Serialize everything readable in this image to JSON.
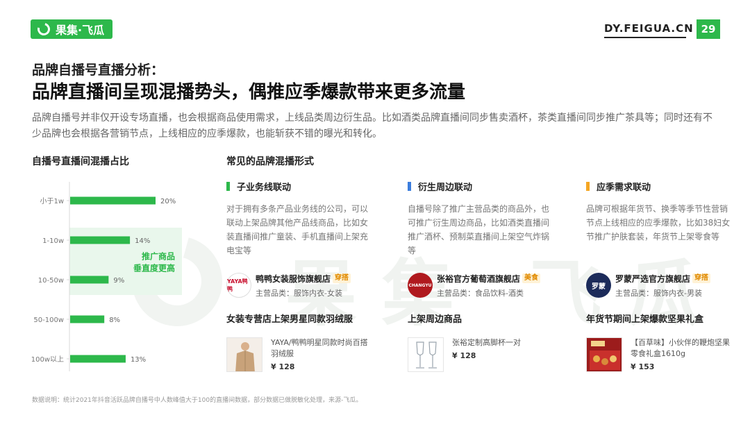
{
  "header": {
    "logo_text": "果集·飞瓜",
    "site": "DY.FEIGUA.CN",
    "page_number": "29"
  },
  "watermark": "果集 飞瓜",
  "kicker": "品牌自播号直播分析：",
  "headline": "品牌直播间呈现混播势头，偶推应季爆款带来更多流量",
  "lead": "品牌自播号并非仅开设专场直播，也会根据商品使用需求，上线品类周边衍生品。比如酒类品牌直播间同步售卖酒杯，茶类直播间同步推广茶具等；同时还有不少品牌也会根据各营销节点，上线相应的应季爆款，也能斩获不错的曝光和转化。",
  "chart_title": "自播号直播间混播占比",
  "chart_data": {
    "type": "bar",
    "orientation": "horizontal",
    "categories": [
      "小于1w",
      "1-10w",
      "10-50w",
      "50-100w",
      "100w以上"
    ],
    "values": [
      20,
      14,
      9,
      8,
      13
    ],
    "value_labels": [
      "20%",
      "14%",
      "9%",
      "8%",
      "13%"
    ],
    "xlim": [
      0,
      20
    ],
    "bar_color": "#2db84b",
    "highlight": {
      "categories": [
        "1-10w",
        "10-50w"
      ],
      "label_line1": "推广商品",
      "label_line2": "垂直度更高",
      "color": "#e9f7ec",
      "text_color": "#2db84b"
    }
  },
  "common_title": "常见的品牌混播形式",
  "columns": [
    {
      "heading": "子业务线联动",
      "accent": "#2db84b",
      "description": "对于拥有多条产品业务线的公司，可以联动上架品牌其他产品线商品，比如女装直播间推广童装、手机直播间上架充电宝等",
      "brand": {
        "logo_text": "YAYA鸭鸭",
        "logo_bg": "#ffffff",
        "logo_fg": "#c8102e",
        "name": "鸭鸭女装服饰旗舰店",
        "tag": "穿搭",
        "category": "主营品类：服饰内衣-女装"
      },
      "sub_title": "女装专营店上架男星同款羽绒服",
      "product": {
        "name": "YAYA/鸭鸭明星同款时尚百搭羽绒服",
        "price": "¥ 128",
        "image": "jacket-photo"
      }
    },
    {
      "heading": "衍生周边联动",
      "accent": "#3b7ddd",
      "description": "自播号除了推广主营品类的商品外，也可推广衍生周边商品，比如酒类直播间推广酒杯、预制菜直播间上架空气炸锅等",
      "brand": {
        "logo_text": "CHANGYU",
        "logo_bg": "#b0191e",
        "logo_fg": "#ffffff",
        "name": "张裕官方葡萄酒旗舰店",
        "tag": "美食",
        "category": "主营品类：食品饮料-酒类"
      },
      "sub_title": "上架周边商品",
      "product": {
        "name": "张裕定制高脚杯一对",
        "price": "¥ 128",
        "image": "wine-glasses"
      }
    },
    {
      "heading": "应季需求联动",
      "accent": "#f5a623",
      "description": "品牌可根据年货节、换季等季节性营销节点上线相应的应季爆款，比如38妇女节推广护肤套装，年货节上架零食等",
      "brand": {
        "logo_text": "罗蒙",
        "logo_bg": "#1c2b5a",
        "logo_fg": "#ffffff",
        "name": "罗蒙严选官方旗舰店",
        "tag": "穿搭",
        "category": "主营品类：服饰内衣-男装"
      },
      "sub_title": "年货节期间上架爆款坚果礼盒",
      "product": {
        "name": "【百草味】小伙伴的鞭炮坚果零食礼盒1610g",
        "price": "¥ 153",
        "image": "gift-box"
      }
    }
  ],
  "footnote": "数据说明：统计2021年抖音活跃品牌自播号中人数峰值大于100的直播间数据，部分数据已做脱敏化处理，来源-飞瓜。",
  "colors": {
    "brand_green": "#2db84b",
    "tag_bg": "#fff2d6",
    "tag_fg": "#e08a00"
  }
}
